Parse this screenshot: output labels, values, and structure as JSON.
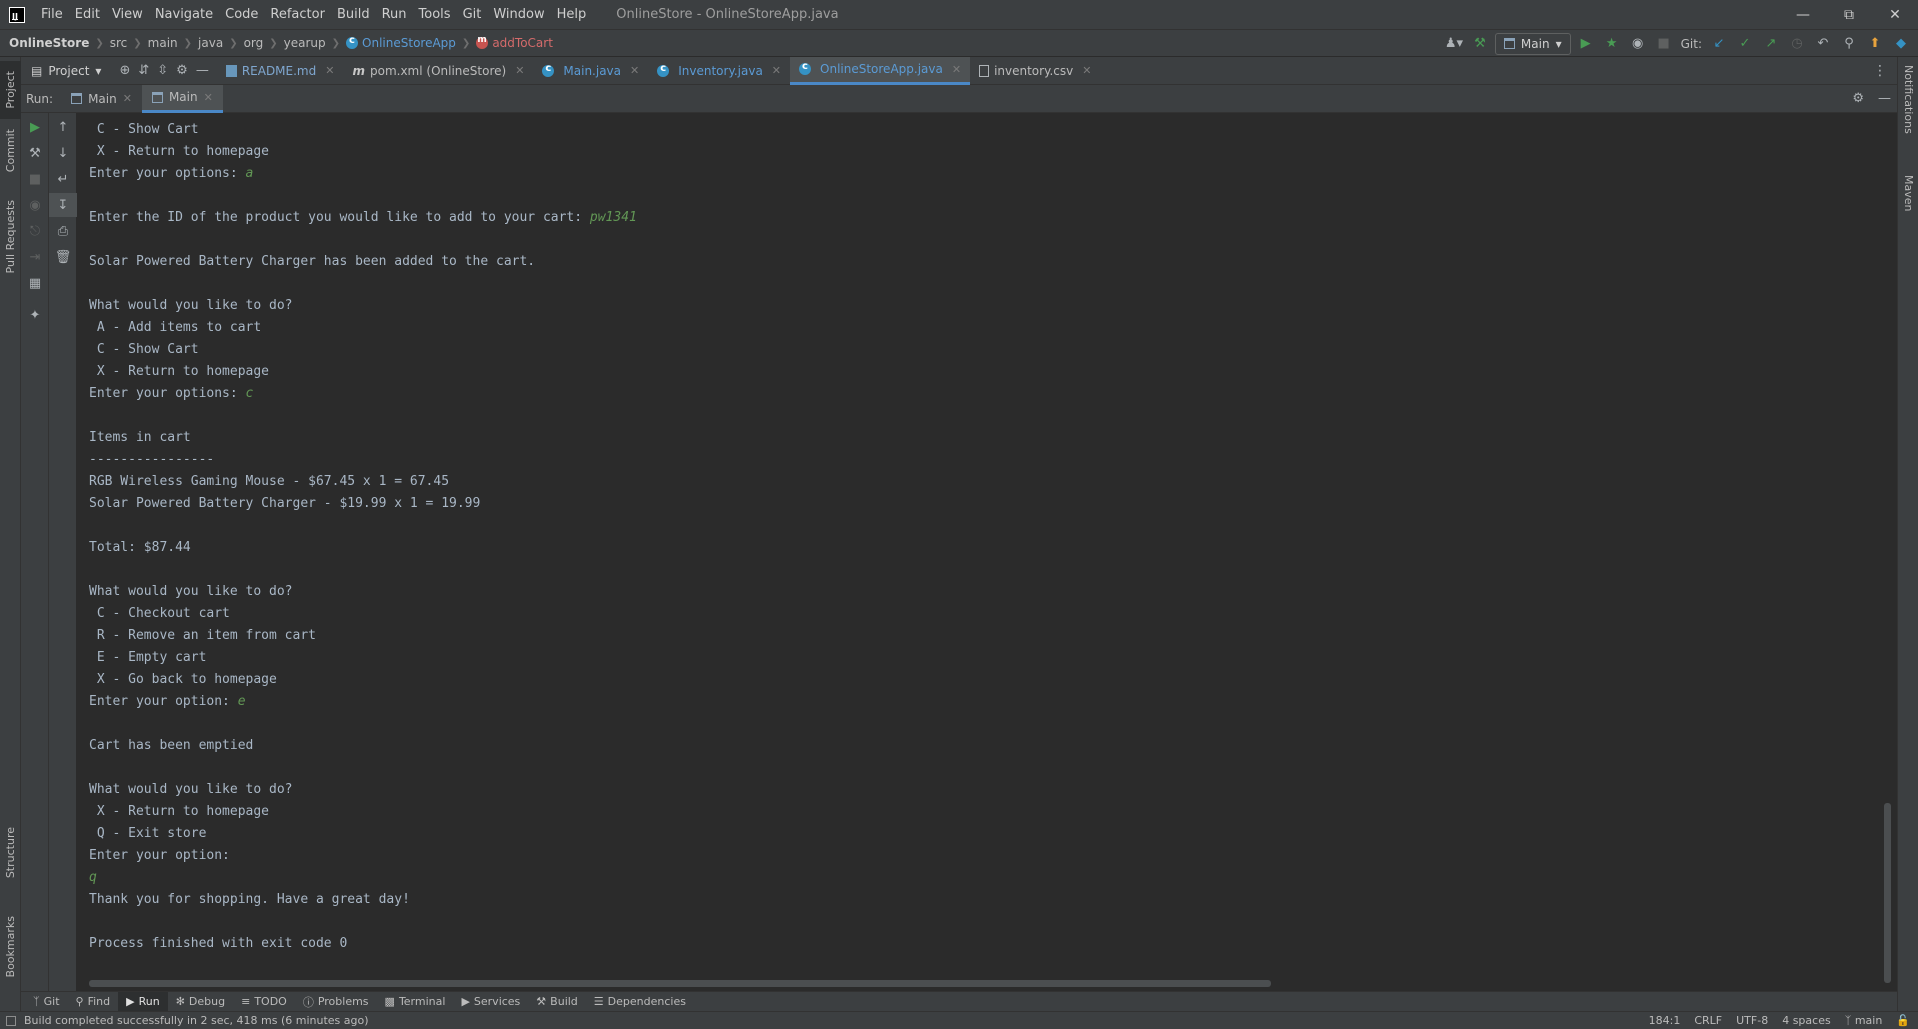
{
  "menubar": {
    "items": [
      "File",
      "Edit",
      "View",
      "Navigate",
      "Code",
      "Refactor",
      "Build",
      "Run",
      "Tools",
      "Git",
      "Window",
      "Help"
    ],
    "window_title": "OnlineStore - OnlineStoreApp.java"
  },
  "breadcrumb": {
    "project": "OnlineStore",
    "parts": [
      "src",
      "main",
      "java",
      "org",
      "yearup"
    ],
    "class": "OnlineStoreApp",
    "method": "addToCart"
  },
  "toolbar": {
    "run_config": "Main",
    "git_label": "Git:"
  },
  "left_stripe": {
    "project": "Project",
    "commit": "Commit",
    "pull_requests": "Pull Requests",
    "structure": "Structure",
    "bookmarks": "Bookmarks"
  },
  "right_stripe": {
    "notifications": "Notifications",
    "maven": "Maven"
  },
  "project_pane": {
    "label": "Project"
  },
  "editor_tabs": [
    {
      "label": "README.md"
    },
    {
      "label": "pom.xml (OnlineStore)"
    },
    {
      "label": "Main.java"
    },
    {
      "label": "Inventory.java"
    },
    {
      "label": "OnlineStoreApp.java"
    },
    {
      "label": "inventory.csv"
    }
  ],
  "run_window": {
    "label": "Run:",
    "tabs": [
      {
        "label": "Main"
      },
      {
        "label": "Main"
      }
    ]
  },
  "console": {
    "lines": [
      {
        "text": " C - Show Cart",
        "input": ""
      },
      {
        "text": " X - Return to homepage",
        "input": ""
      },
      {
        "text": "Enter your options: ",
        "input": "a"
      },
      {
        "text": "",
        "input": ""
      },
      {
        "text": "Enter the ID of the product you would like to add to your cart: ",
        "input": "pw1341"
      },
      {
        "text": "",
        "input": ""
      },
      {
        "text": "Solar Powered Battery Charger has been added to the cart.",
        "input": ""
      },
      {
        "text": "",
        "input": ""
      },
      {
        "text": "What would you like to do?",
        "input": ""
      },
      {
        "text": " A - Add items to cart",
        "input": ""
      },
      {
        "text": " C - Show Cart",
        "input": ""
      },
      {
        "text": " X - Return to homepage",
        "input": ""
      },
      {
        "text": "Enter your options: ",
        "input": "c"
      },
      {
        "text": "",
        "input": ""
      },
      {
        "text": "Items in cart",
        "input": ""
      },
      {
        "text": "----------------",
        "input": ""
      },
      {
        "text": "RGB Wireless Gaming Mouse - $67.45 x 1 = 67.45",
        "input": ""
      },
      {
        "text": "Solar Powered Battery Charger - $19.99 x 1 = 19.99",
        "input": ""
      },
      {
        "text": "",
        "input": ""
      },
      {
        "text": "Total: $87.44",
        "input": ""
      },
      {
        "text": "",
        "input": ""
      },
      {
        "text": "What would you like to do?",
        "input": ""
      },
      {
        "text": " C - Checkout cart",
        "input": ""
      },
      {
        "text": " R - Remove an item from cart",
        "input": ""
      },
      {
        "text": " E - Empty cart",
        "input": ""
      },
      {
        "text": " X - Go back to homepage",
        "input": ""
      },
      {
        "text": "Enter your option: ",
        "input": "e"
      },
      {
        "text": "",
        "input": ""
      },
      {
        "text": "Cart has been emptied",
        "input": ""
      },
      {
        "text": "",
        "input": ""
      },
      {
        "text": "What would you like to do?",
        "input": ""
      },
      {
        "text": " X - Return to homepage",
        "input": ""
      },
      {
        "text": " Q - Exit store",
        "input": ""
      },
      {
        "text": "Enter your option:",
        "input": ""
      },
      {
        "text": "",
        "input": "q"
      },
      {
        "text": "Thank you for shopping. Have a great day!",
        "input": ""
      },
      {
        "text": "",
        "input": ""
      },
      {
        "text": "Process finished with exit code 0",
        "input": ""
      }
    ]
  },
  "bottom_tools": [
    {
      "label": "Git",
      "icon": "git-branch-icon"
    },
    {
      "label": "Find",
      "icon": "search-icon"
    },
    {
      "label": "Run",
      "icon": "run-icon"
    },
    {
      "label": "Debug",
      "icon": "bug-icon"
    },
    {
      "label": "TODO",
      "icon": "list-icon"
    },
    {
      "label": "Problems",
      "icon": "info-icon"
    },
    {
      "label": "Terminal",
      "icon": "terminal-icon"
    },
    {
      "label": "Services",
      "icon": "services-icon"
    },
    {
      "label": "Build",
      "icon": "hammer-icon"
    },
    {
      "label": "Dependencies",
      "icon": "layers-icon"
    }
  ],
  "status": {
    "message": "Build completed successfully in 2 sec, 418 ms (6 minutes ago)",
    "position": "184:1",
    "line_sep": "CRLF",
    "encoding": "UTF-8",
    "indent": "4 spaces",
    "branch": "main"
  },
  "colors": {
    "accent": "#4a88c7",
    "console_text": "#a9b7c6",
    "user_input": "#629755",
    "run_green": "#499c54"
  }
}
